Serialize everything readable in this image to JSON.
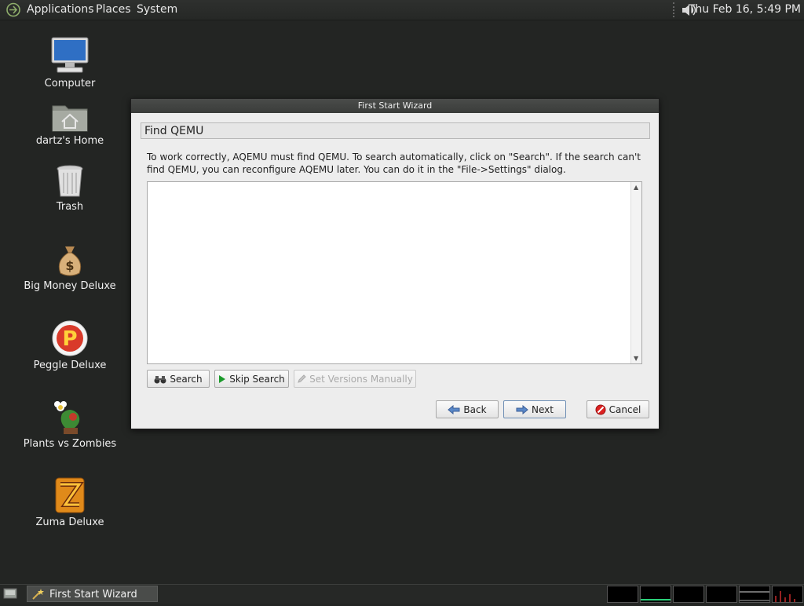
{
  "top_panel": {
    "menus": [
      "Applications",
      "Places",
      "System"
    ],
    "clock": "Thu Feb 16,  5:49 PM",
    "icons": [
      "app-logo-icon",
      "volume-icon"
    ]
  },
  "desktop_icons": [
    {
      "label": "Computer",
      "icon": "computer-icon"
    },
    {
      "label": "dartz's Home",
      "icon": "home-folder-icon"
    },
    {
      "label": "Trash",
      "icon": "trash-icon"
    },
    {
      "label": "Big Money Deluxe",
      "icon": "money-bag-icon"
    },
    {
      "label": "Peggle Deluxe",
      "icon": "peggle-icon"
    },
    {
      "label": "Plants vs Zombies",
      "icon": "plants-icon"
    },
    {
      "label": "Zuma Deluxe",
      "icon": "zuma-icon"
    }
  ],
  "dialog": {
    "title": "First Start Wizard",
    "header": "Find QEMU",
    "description": "To work correctly, AQEMU must find QEMU. To search automatically, click on \"Search\". If the search can't find QEMU, you can reconfigure AQEMU later. You can do it in the \"File->Settings\" dialog.",
    "output_text": "",
    "buttons": {
      "search": "Search",
      "skip_search": "Skip Search",
      "set_versions": "Set Versions Manually",
      "back": "Back",
      "next": "Next",
      "cancel": "Cancel"
    }
  },
  "bottom_panel": {
    "task_label": "First Start Wizard"
  },
  "colors": {
    "desktop": "#232523",
    "panel": "#2a2c2a",
    "dialog_bg": "#ededed"
  }
}
